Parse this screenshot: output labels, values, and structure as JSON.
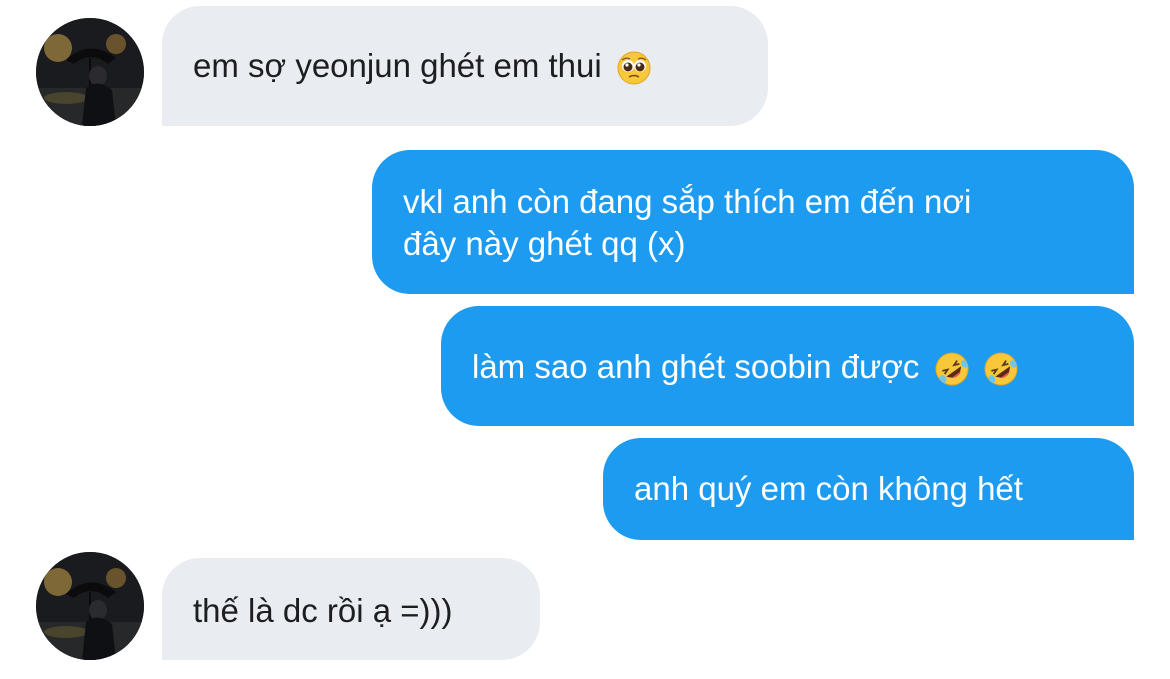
{
  "conversation": {
    "messages": [
      {
        "side": "incoming",
        "text": "em sợ yeonjun ghét em thui",
        "emoji": [
          "pleading-face"
        ]
      },
      {
        "side": "outgoing",
        "line1": "vkl anh còn đang sắp thích em đến nơi",
        "line2": "đây này ghét qq (x)"
      },
      {
        "side": "outgoing",
        "text": "làm sao anh ghét soobin được",
        "emoji": [
          "rolling-on-floor-laughing",
          "rolling-on-floor-laughing"
        ]
      },
      {
        "side": "outgoing",
        "text": "anh quý em còn không hết"
      },
      {
        "side": "incoming",
        "text": "thế là dc rồi ạ =)))"
      }
    ]
  },
  "colors": {
    "incoming_bubble": "#e9ecf0",
    "outgoing_bubble": "#1d9bf0"
  }
}
